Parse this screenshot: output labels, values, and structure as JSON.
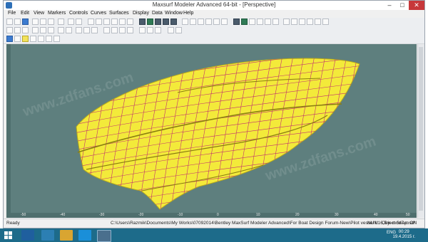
{
  "window": {
    "title": "Maxsurf Modeler Advanced 64-bit - [Perspective]",
    "min_glyph": "–",
    "max_glyph": "□",
    "close_glyph": "✕"
  },
  "menu": [
    "File",
    "Edit",
    "View",
    "Markers",
    "Controls",
    "Curves",
    "Surfaces",
    "Display",
    "Data",
    "Window",
    "Help"
  ],
  "viewport": {
    "view_name": "Perspective",
    "hull_color": "#f3ea3a",
    "grid_color": "#c2306f",
    "background": "#5e7f7e",
    "ruler_bottom": [
      "-50",
      "-40",
      "-30",
      "-20",
      "-10",
      "0",
      "10",
      "20",
      "30",
      "40",
      "50"
    ]
  },
  "status": {
    "left": "Ready",
    "path": "C:\\Users\\Razmik\\Documents\\My Works\\07092014\\Bentley MaxSurf Modeler Advanced\\For Boat Design Forum-New\\Pilot vessel L16,5m-mod7.msd*",
    "num": "NUM",
    "snap": "Object Snap: ON"
  },
  "taskbar": {
    "tray_lang": "ENG",
    "time": "00:29",
    "date": "19.4.2015 г."
  }
}
